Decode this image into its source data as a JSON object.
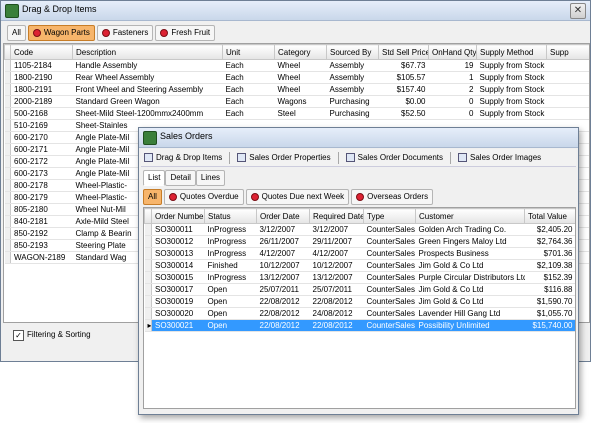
{
  "main_window": {
    "title": "Drag & Drop Items",
    "close_glyph": "✕",
    "tabs": [
      {
        "label": "All",
        "pin": false,
        "active": false
      },
      {
        "label": "Wagon Parts",
        "pin": true,
        "active": true
      },
      {
        "label": "Fasteners",
        "pin": true,
        "active": false
      },
      {
        "label": "Fresh Fruit",
        "pin": true,
        "active": false
      }
    ],
    "columns": [
      "Code",
      "Description",
      "Unit",
      "Category",
      "Sourced By",
      "Std Sell Price",
      "OnHand Qty",
      "Supply Method",
      "Supp"
    ],
    "rows": [
      [
        "1105-2184",
        "Handle Assembly",
        "Each",
        "Wheel",
        "Assembly",
        "$67.73",
        "19",
        "Supply from Stock"
      ],
      [
        "1800-2190",
        "Rear Wheel Assembly",
        "Each",
        "Wheel",
        "Assembly",
        "$105.57",
        "1",
        "Supply from Stock"
      ],
      [
        "1800-2191",
        "Front Wheel and Steering Assembly",
        "Each",
        "Wheel",
        "Assembly",
        "$157.40",
        "2",
        "Supply from Stock"
      ],
      [
        "2000-2189",
        "Standard Green Wagon",
        "Each",
        "Wagons",
        "Purchasing",
        "$0.00",
        "0",
        "Supply from Stock"
      ],
      [
        "500-2168",
        "Sheet-Mild Steel-1200mmx2400mm",
        "Each",
        "Steel",
        "Purchasing",
        "$52.50",
        "0",
        "Supply from Stock"
      ],
      [
        "510-2169",
        "Sheet-Stainles",
        "",
        "",
        "",
        "",
        "",
        ""
      ],
      [
        "600-2170",
        "Angle Plate-Mil",
        "",
        "",
        "",
        "",
        "",
        ""
      ],
      [
        "600-2171",
        "Angle Plate-Mil",
        "",
        "",
        "",
        "",
        "",
        ""
      ],
      [
        "600-2172",
        "Angle Plate-Mil",
        "",
        "",
        "",
        "",
        "",
        ""
      ],
      [
        "600-2173",
        "Angle Plate-Mil",
        "",
        "",
        "",
        "",
        "",
        ""
      ],
      [
        "800-2178",
        "Wheel-Plastic-",
        "",
        "",
        "",
        "",
        "",
        ""
      ],
      [
        "800-2179",
        "Wheel-Plastic-",
        "",
        "",
        "",
        "",
        "",
        ""
      ],
      [
        "805-2180",
        "Wheel Nut-Mil",
        "",
        "",
        "",
        "",
        "",
        ""
      ],
      [
        "840-2181",
        "Axle-Mild Steel",
        "",
        "",
        "",
        "",
        "",
        ""
      ],
      [
        "850-2192",
        "Clamp & Bearin",
        "",
        "",
        "",
        "",
        "",
        ""
      ],
      [
        "850-2193",
        "Steering Plate",
        "",
        "",
        "",
        "",
        "",
        ""
      ],
      [
        "WAGON-2189",
        "Standard Wag",
        "",
        "",
        "",
        "",
        "",
        ""
      ]
    ],
    "filtering_label": "Filtering & Sorting",
    "filtering_checked": "✓"
  },
  "sales_window": {
    "title": "Sales Orders",
    "toolbar": [
      {
        "label": "Drag & Drop Items",
        "icon": "drag-drop-icon"
      },
      {
        "label": "Sales Order Properties",
        "icon": "properties-icon"
      },
      {
        "label": "Sales Order Documents",
        "icon": "documents-icon"
      },
      {
        "label": "Sales Order Images",
        "icon": "images-icon"
      }
    ],
    "tabs": [
      "List",
      "Detail",
      "Lines"
    ],
    "filters": [
      {
        "label": "All",
        "pin": false,
        "active": true
      },
      {
        "label": "Quotes Overdue",
        "pin": true,
        "active": false
      },
      {
        "label": "Quotes Due next Week",
        "pin": true,
        "active": false
      },
      {
        "label": "Overseas Orders",
        "pin": true,
        "active": false
      }
    ],
    "columns": [
      "Order Number",
      "Status",
      "Order Date",
      "Required Date",
      "Type",
      "Customer",
      "Total Value"
    ],
    "rows": [
      [
        "SO300011",
        "InProgress",
        "3/12/2007",
        "3/12/2007",
        "CounterSales",
        "Golden Arch Trading Co.",
        "$2,405.20"
      ],
      [
        "SO300012",
        "InProgress",
        "26/11/2007",
        "29/11/2007",
        "CounterSales",
        "Green Fingers Maloy Ltd",
        "$2,764.36"
      ],
      [
        "SO300013",
        "InProgress",
        "4/12/2007",
        "4/12/2007",
        "CounterSales",
        "Prospects Business",
        "$701.36"
      ],
      [
        "SO300014",
        "Finished",
        "10/12/2007",
        "10/12/2007",
        "CounterSales",
        "Jim Gold & Co Ltd",
        "$2,109.38"
      ],
      [
        "SO300015",
        "InProgress",
        "13/12/2007",
        "13/12/2007",
        "CounterSales",
        "Purple Circular Distributors Ltd",
        "$152.39"
      ],
      [
        "SO300017",
        "Open",
        "25/07/2011",
        "25/07/2011",
        "CounterSales",
        "Jim Gold & Co Ltd",
        "$116.88"
      ],
      [
        "SO300019",
        "Open",
        "22/08/2012",
        "22/08/2012",
        "CounterSales",
        "Jim Gold & Co Ltd",
        "$1,590.70"
      ],
      [
        "SO300020",
        "Open",
        "22/08/2012",
        "24/08/2012",
        "CounterSales",
        "Lavender Hill Gang Ltd",
        "$1,055.70"
      ],
      [
        "SO300021",
        "Open",
        "22/08/2012",
        "22/08/2012",
        "CounterSales",
        "Possibility Unlimited",
        "$15,740.00"
      ]
    ],
    "selected_row": 8
  }
}
